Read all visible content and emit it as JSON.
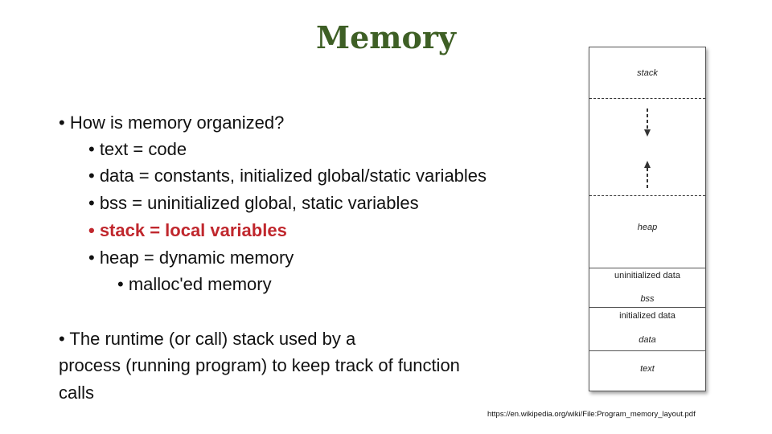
{
  "title": "Memory",
  "bullets": [
    {
      "text": "• How is memory organized?"
    },
    {
      "text": "• text = code"
    },
    {
      "text": "• data = constants, initialized global/static variables"
    },
    {
      "text": "• bss = uninitialized global, static variables"
    },
    {
      "text": "• stack = local variables"
    },
    {
      "text": "• heap = dynamic memory"
    },
    {
      "text": "• malloc'ed memory"
    }
  ],
  "paragraph": [
    "• The runtime (or call) stack used by a",
    "process (running program) to keep track of function",
    "calls"
  ],
  "diagram": {
    "stack": "stack",
    "heap": "heap",
    "uninitialized": "uninitialized data",
    "bss": "bss",
    "initialized": "initialized data",
    "data": "data",
    "text": "text",
    "arrow_down": "arrow-down",
    "arrow_up": "arrow-up"
  },
  "citation": "https://en.wikipedia.org/wiki/File:Program_memory_layout.pdf",
  "colors": {
    "title": "#3e5f25",
    "highlight": "#c0272d"
  }
}
